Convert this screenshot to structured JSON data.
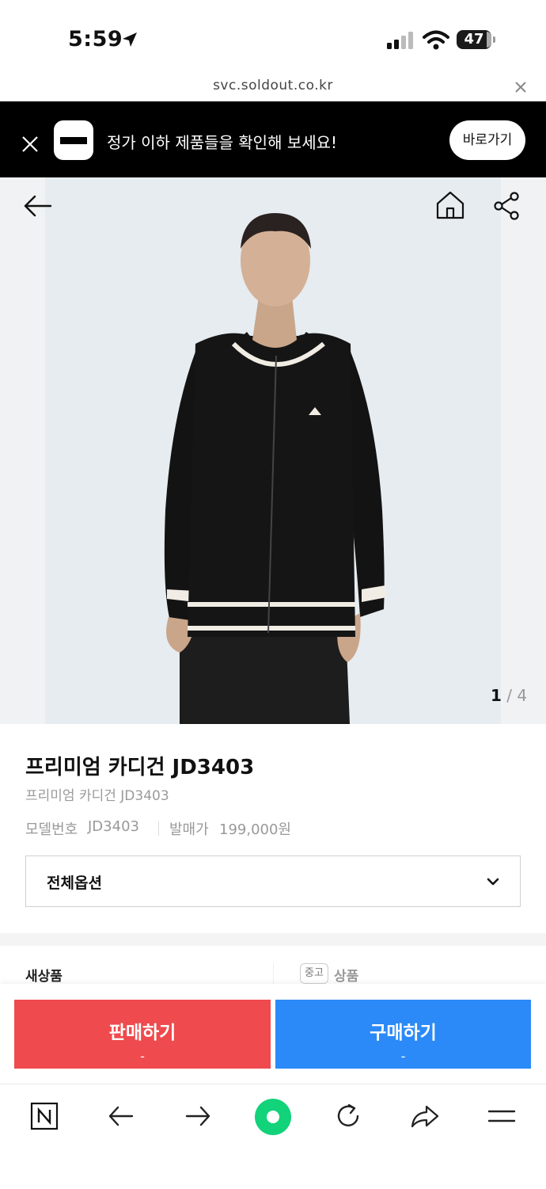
{
  "status_bar": {
    "time": "5:59",
    "battery": "47"
  },
  "browser": {
    "url": "svc.soldout.co.kr"
  },
  "banner": {
    "text": "정가 이하 제품들을 확인해 보세요!",
    "button_label": "바로가기"
  },
  "gallery": {
    "current": "1",
    "separator": "/",
    "total": "4"
  },
  "product": {
    "title": "프리미엄 카디건 JD3403",
    "subtitle": "프리미엄 카디건 JD3403",
    "model_label": "모델번호",
    "model_value": "JD3403",
    "price_label": "발매가",
    "price_value": "199,000원",
    "option_label": "전체옵션"
  },
  "tabs": {
    "new_label": "새상품",
    "used_badge": "중고",
    "used_label": "상품"
  },
  "actions": {
    "sell_label": "판매하기",
    "sell_price": "-",
    "buy_label": "구매하기",
    "buy_price": "-",
    "sell_color": "#ef4a4d",
    "buy_color": "#2b8af7"
  },
  "icons": [
    "location-arrow-icon",
    "cellular-signal-icon",
    "wifi-icon",
    "battery-icon",
    "close-icon",
    "logo-icon",
    "back-arrow-icon",
    "home-icon",
    "share-icon",
    "chevron-down-icon",
    "naver-n-icon",
    "nav-back-icon",
    "nav-forward-icon",
    "green-dot-icon",
    "reload-icon",
    "forward-share-icon",
    "menu-icon"
  ]
}
